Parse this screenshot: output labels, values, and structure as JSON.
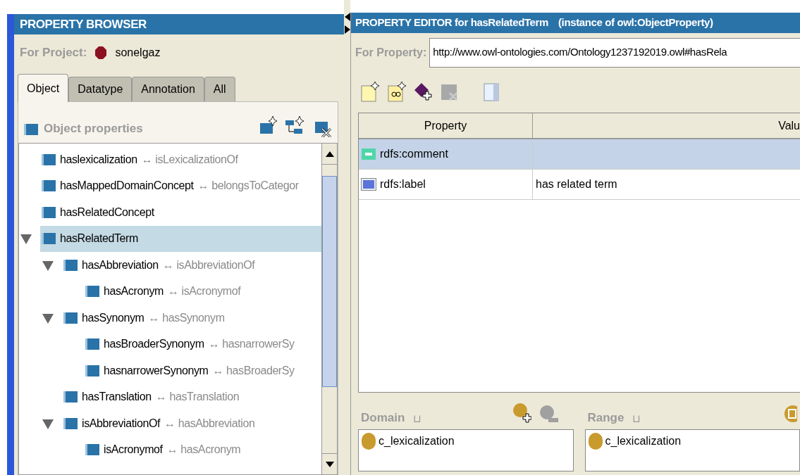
{
  "property_browser": {
    "title": "PROPERTY BROWSER",
    "project_label": "For Project:",
    "project_name": "sonelgaz",
    "tabs": [
      {
        "label": "Object",
        "selected": true
      },
      {
        "label": "Datatype",
        "selected": false
      },
      {
        "label": "Annotation",
        "selected": false
      },
      {
        "label": "All",
        "selected": false
      }
    ],
    "section_title": "Object properties",
    "tree": [
      {
        "name": "haslexicalization",
        "inverse": "↔ isLexicalizationOf",
        "selected": false
      },
      {
        "name": "hasMappedDomainConcept",
        "inverse": "↔ belongsToCategor",
        "selected": false
      },
      {
        "name": "hasRelatedConcept",
        "selected": false
      },
      {
        "name": "hasRelatedTerm",
        "selected": true,
        "expanded": true,
        "children": [
          {
            "name": "hasAbbreviation",
            "inverse": "↔ isAbbreviationOf",
            "selected": false,
            "expanded": true,
            "children": [
              {
                "name": "hasAcronym",
                "inverse": "↔ isAcronymof",
                "selected": false
              }
            ]
          },
          {
            "name": "hasSynonym",
            "inverse": "↔ hasSynonym",
            "selected": false,
            "expanded": true,
            "children": [
              {
                "name": "hasBroaderSynonym",
                "inverse": "↔ hasnarrowerSy",
                "selected": false
              },
              {
                "name": "hasnarrowerSynonym",
                "inverse": "↔ hasBroaderSy",
                "selected": false
              }
            ]
          },
          {
            "name": "hasTranslation",
            "inverse": "↔ hasTranslation",
            "selected": false
          },
          {
            "name": "isAbbreviationOf",
            "inverse": "↔ hasAbbreviation",
            "selected": false,
            "expanded": true,
            "children": [
              {
                "name": "isAcronymof",
                "inverse": "↔ hasAcronym",
                "selected": false
              }
            ]
          }
        ]
      }
    ]
  },
  "property_editor": {
    "title": "PROPERTY EDITOR for hasRelatedTerm",
    "subtitle": "(instance of owl:ObjectProperty)",
    "for_property_label": "For Property:",
    "for_property_value": "http://www.owl-ontologies.com/Ontology1237192019.owl#hasRela",
    "table": {
      "columns": [
        "Property",
        "Valu"
      ],
      "rows": [
        {
          "kind": "comment",
          "property": "rdfs:comment",
          "selected": true
        },
        {
          "kind": "label",
          "property": "rdfs:label",
          "value": "has related term",
          "selected": false
        }
      ]
    },
    "domain": {
      "label": "Domain",
      "symbol": "⊔",
      "items": [
        "c_lexicalization"
      ]
    },
    "range": {
      "label": "Range",
      "symbol": "⊔",
      "items": [
        "c_lexicalization"
      ]
    }
  }
}
